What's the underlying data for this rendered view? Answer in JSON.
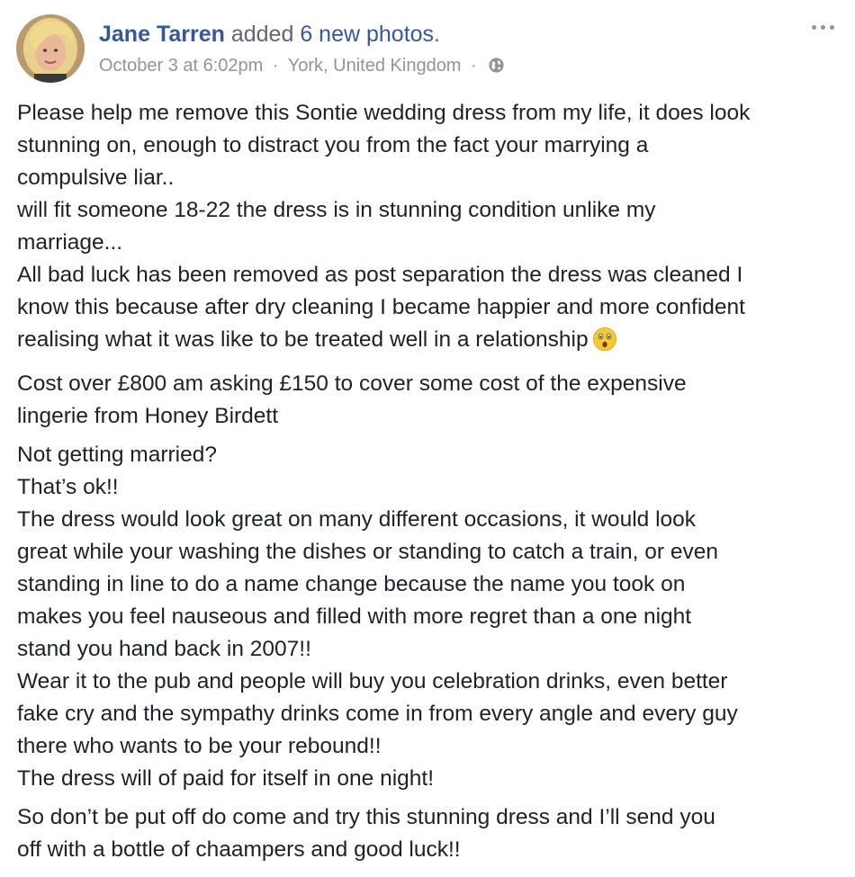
{
  "post": {
    "author": {
      "name": "Jane Tarren",
      "action_prefix": "added",
      "action_link": "6 new photos",
      "action_suffix": "."
    },
    "meta": {
      "time": "October 3 at 6:02pm",
      "separator": "·",
      "location": "York, United Kingdom",
      "privacy_icon": "globe-icon"
    },
    "more_icon": "more-options-icon",
    "paragraphs": [
      {
        "lines": [
          "Please help me remove this Sontie wedding dress from my life, it does look",
          "stunning on, enough to distract you from the fact your marrying a",
          "compulsive liar..",
          "will fit someone 18-22 the dress is in stunning condition unlike my",
          "marriage...",
          "All bad luck has been removed as post separation the dress was cleaned I",
          "know this because after dry cleaning I became happier and more confident",
          "realising what it was like to be treated well in a relationship"
        ],
        "trailing_emoji": "astonished-face-emoji"
      },
      {
        "lines": [
          "Cost over £800 am asking £150 to cover some cost of the expensive",
          "lingerie from Honey Birdett"
        ]
      },
      {
        "lines": [
          "Not getting married?",
          "That’s ok!!",
          "The dress would look great on many different occasions, it would look",
          "great while your washing the dishes or standing to catch a train, or even",
          "standing in line to do a name change because the name you took on",
          "makes you feel nauseous and filled with more regret than a one night",
          "stand you hand back in 2007!!",
          "Wear it to the pub and people will buy you celebration drinks, even better",
          "fake cry and the sympathy drinks come in from every angle and every guy",
          "there who wants to be your rebound!!",
          "The dress will of paid for itself in one night!"
        ]
      },
      {
        "lines": [
          "So don’t be put off do come and try this stunning dress and I’ll send you",
          "off with a bottle of chaampers and good luck!!"
        ]
      }
    ]
  }
}
